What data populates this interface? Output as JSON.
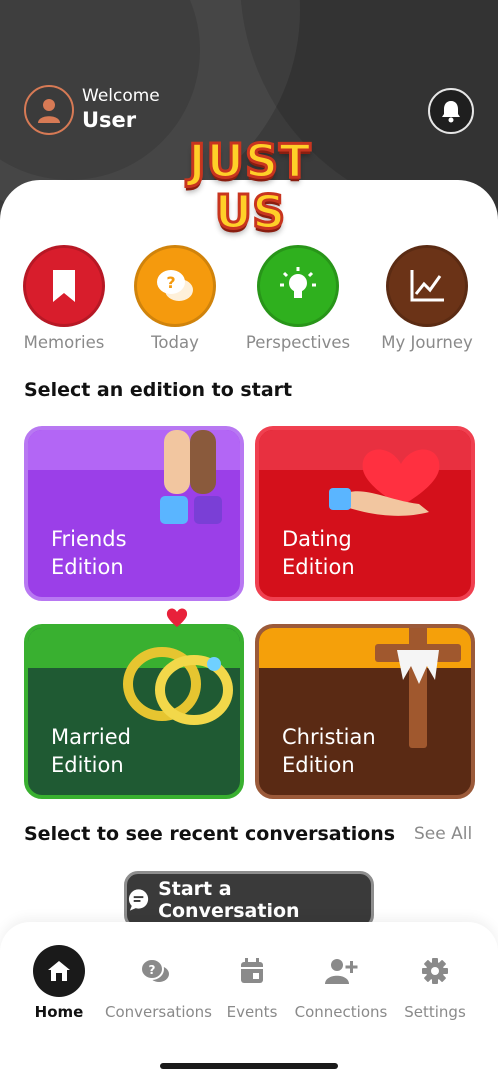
{
  "header": {
    "welcome_label": "Welcome",
    "user_name": "User"
  },
  "logo": {
    "line1": "JUST",
    "line2": "US"
  },
  "quick_actions": [
    {
      "label": "Memories",
      "icon": "bookmark-icon",
      "color": "#d81d2c"
    },
    {
      "label": "Today",
      "icon": "question-chat-icon",
      "color": "#f59a0d"
    },
    {
      "label": "Perspectives",
      "icon": "lightbulb-icon",
      "color": "#2fb01e"
    },
    {
      "label": "My Journey",
      "icon": "chart-icon",
      "color": "#6b3317"
    }
  ],
  "editions_section": {
    "title": "Select an edition to start"
  },
  "editions": [
    {
      "line1": "Friends",
      "line2": "Edition",
      "color": "#9b3fe8",
      "icon": "high-five-icon"
    },
    {
      "line1": "Dating",
      "line2": "Edition",
      "color": "#d4101b",
      "icon": "heart-hands-icon"
    },
    {
      "line1": "Married",
      "line2": "Edition",
      "color": "#1f5a33",
      "icon": "rings-icon"
    },
    {
      "line1": "Christian",
      "line2": "Edition",
      "color": "#5a2a14",
      "icon": "cross-icon"
    }
  ],
  "recent": {
    "title": "Select to see recent conversations",
    "see_all": "See All"
  },
  "start_button": {
    "label": "Start a Conversation"
  },
  "tabs": [
    {
      "label": "Home",
      "icon": "home-icon",
      "active": true
    },
    {
      "label": "Conversations",
      "icon": "conversations-icon",
      "active": false
    },
    {
      "label": "Events",
      "icon": "calendar-icon",
      "active": false
    },
    {
      "label": "Connections",
      "icon": "add-person-icon",
      "active": false
    },
    {
      "label": "Settings",
      "icon": "gear-icon",
      "active": false
    }
  ]
}
